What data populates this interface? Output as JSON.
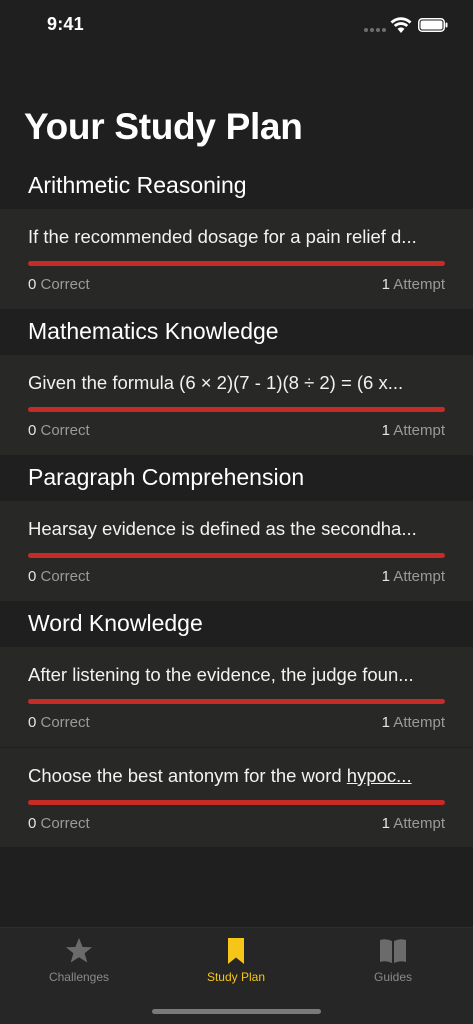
{
  "status_bar": {
    "time": "9:41"
  },
  "page_title": "Your Study Plan",
  "sections": [
    {
      "header": "Arithmetic Reasoning",
      "items": [
        {
          "question": "If the recommended dosage for a pain relief d...",
          "correct_count": "0",
          "correct_label": " Correct",
          "attempt_count": "1",
          "attempt_label": " Attempt"
        }
      ]
    },
    {
      "header": "Mathematics Knowledge",
      "items": [
        {
          "question": "Given the formula (6 × 2)(7 - 1)(8 ÷ 2) = (6 x...",
          "correct_count": "0",
          "correct_label": " Correct",
          "attempt_count": "1",
          "attempt_label": " Attempt"
        }
      ]
    },
    {
      "header": "Paragraph Comprehension",
      "items": [
        {
          "question": "Hearsay evidence is defined as the secondha...",
          "correct_count": "0",
          "correct_label": " Correct",
          "attempt_count": "1",
          "attempt_label": " Attempt"
        }
      ]
    },
    {
      "header": "Word Knowledge",
      "items": [
        {
          "question": "After listening to the evidence, the judge foun...",
          "correct_count": "0",
          "correct_label": " Correct",
          "attempt_count": "1",
          "attempt_label": " Attempt"
        },
        {
          "question_prefix": "Choose the best antonym for the word ",
          "question_underlined": "hypoc...",
          "correct_count": "0",
          "correct_label": " Correct",
          "attempt_count": "1",
          "attempt_label": " Attempt"
        }
      ]
    }
  ],
  "tabs": [
    {
      "label": "Challenges",
      "icon": "star-icon"
    },
    {
      "label": "Study Plan",
      "icon": "bookmark-icon",
      "active": true
    },
    {
      "label": "Guides",
      "icon": "book-icon"
    }
  ],
  "colors": {
    "accent": "#f5c518",
    "progress": "#c52b27",
    "background": "#1f1f1f",
    "card": "#282826"
  }
}
